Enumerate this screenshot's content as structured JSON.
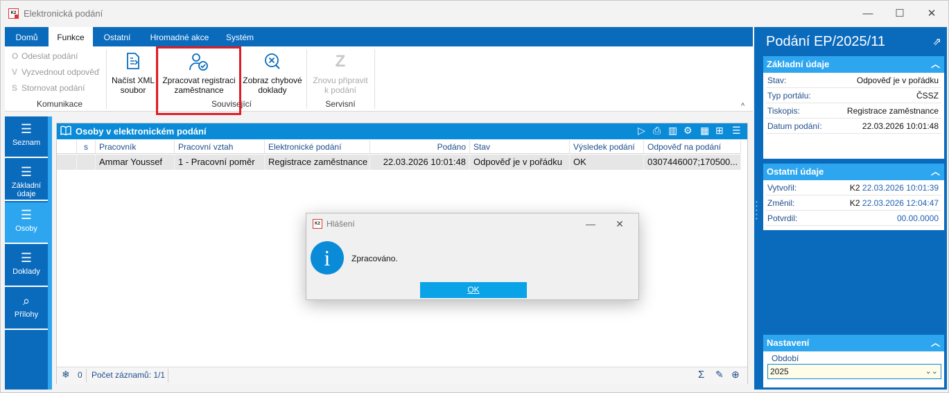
{
  "window": {
    "title": "Elektronická podání",
    "minimize": "—",
    "maximize": "☐",
    "close": "✕"
  },
  "ribbon": {
    "tabs": [
      "Domů",
      "Funkce",
      "Ostatní",
      "Hromadné akce",
      "Systém"
    ],
    "active_tab": "Funkce",
    "komunikace": {
      "items": [
        "Odeslat podání",
        "Vyzvednout odpověď",
        "Stornovat podání"
      ],
      "glyphs": [
        "O",
        "V",
        "S"
      ],
      "label": "Komunikace"
    },
    "nacist_xml": [
      "Načíst XML",
      "soubor"
    ],
    "souvisejici": {
      "zpracovat": [
        "Zpracovat registraci",
        "zaměstnance"
      ],
      "zobraz": [
        "Zobraz chybové",
        "doklady"
      ],
      "label": "Související"
    },
    "servisni": {
      "znovu": [
        "Znovu připravit",
        "k podání"
      ],
      "label": "Servisní"
    },
    "collapse": "^"
  },
  "leftnav": [
    {
      "label": "Seznam",
      "icon": "list-icon",
      "active": false
    },
    {
      "label": "Základní údaje",
      "icon": "list-icon",
      "active": false
    },
    {
      "label": "Osoby",
      "icon": "list-icon",
      "active": true
    },
    {
      "label": "Doklady",
      "icon": "list-icon",
      "active": false
    },
    {
      "label": "Přílohy",
      "icon": "paperclip-icon",
      "active": false
    }
  ],
  "grid": {
    "title": "Osoby v elektronickém podání",
    "columns": [
      "",
      "s",
      "Pracovník",
      "Pracovní vztah",
      "Elektronické podání",
      "Podáno",
      "Stav",
      "Výsledek podání",
      "Odpověď na podání"
    ],
    "rows": [
      [
        "",
        "",
        "Ammar Youssef",
        "1 - Pracovní poměr",
        "Registrace zaměstnance",
        "22.03.2026 10:01:48",
        "Odpověď je v pořádku",
        "OK",
        "0307446007;170500..."
      ]
    ],
    "footer": {
      "count_value": "0",
      "records": "Počet záznamů: 1/1"
    }
  },
  "rpanel": {
    "title": "Podání EP/2025/11",
    "zakladni": {
      "heading": "Základní údaje",
      "rows": [
        {
          "label": "Stav:",
          "value": "Odpověď je v pořádku"
        },
        {
          "label": "Typ portálu:",
          "value": "ČSSZ"
        },
        {
          "label": "Tiskopis:",
          "value": "Registrace zaměstnance"
        },
        {
          "label": "Datum podání:",
          "value": "22.03.2026 10:01:48"
        }
      ]
    },
    "ostatni": {
      "heading": "Ostatní údaje",
      "rows": [
        {
          "label": "Vytvořil:",
          "user": "K2",
          "date": "22.03.2026 10:01:39"
        },
        {
          "label": "Změnil:",
          "user": "K2",
          "date": "22.03.2026 12:04:47"
        },
        {
          "label": "Potvrdil:",
          "user": "",
          "date": "00.00.0000"
        }
      ]
    },
    "nastaveni": {
      "heading": "Nastavení",
      "field_label": "Období",
      "field_value": "2025"
    }
  },
  "dialog": {
    "title": "Hlášení",
    "message": "Zpracováno.",
    "ok": "OK",
    "info_glyph": "i"
  },
  "colors": {
    "primary": "#0a6bbd",
    "accent": "#2ea6ef",
    "highlight": "#e01b24"
  }
}
